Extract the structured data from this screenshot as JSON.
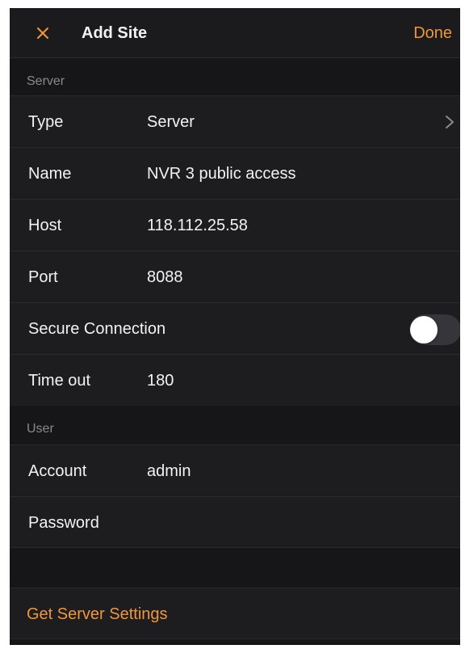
{
  "navbar": {
    "title": "Add Site",
    "done_label": "Done"
  },
  "sections": {
    "server": "Server",
    "user": "User"
  },
  "server_rows": {
    "type_label": "Type",
    "type_value": "Server",
    "name_label": "Name",
    "name_value": "NVR 3 public access",
    "host_label": "Host",
    "host_value": "118.112.25.58",
    "port_label": "Port",
    "port_value": "8088",
    "secure_label": "Secure Connection",
    "secure_enabled": false,
    "timeout_label": "Time out",
    "timeout_value": "180"
  },
  "user_rows": {
    "account_label": "Account",
    "account_value": "admin",
    "password_label": "Password",
    "password_value": ""
  },
  "actions": {
    "get_server_settings": "Get Server Settings"
  },
  "icons": {
    "close": "close-icon",
    "chevron": "chevron-right-icon"
  },
  "colors": {
    "accent": "#f0963c",
    "background": "#161619",
    "row_background": "#1d1d20",
    "text": "#f2f2f2",
    "secondary_text": "#8a8a8e"
  }
}
